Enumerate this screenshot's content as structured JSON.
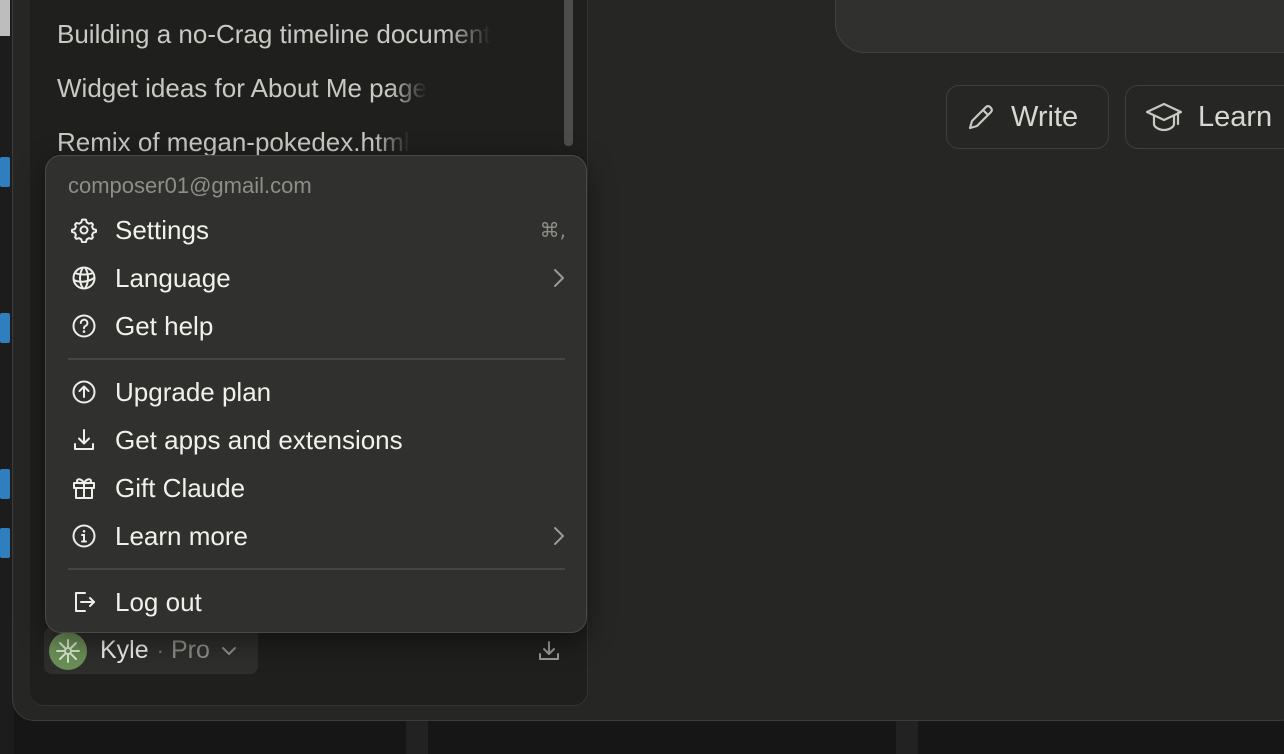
{
  "sidebar": {
    "recent_chats": [
      "Building a no-Crag timeline document",
      "Widget ideas for About Me page",
      "Remix of megan-pokedex.html"
    ]
  },
  "menu": {
    "email": "composer01@gmail.com",
    "items": [
      {
        "label": "Settings",
        "icon": "gear-icon",
        "shortcut": "⌘,"
      },
      {
        "label": "Language",
        "icon": "globe-icon",
        "submenu": true
      },
      {
        "label": "Get help",
        "icon": "help-circle-icon"
      },
      {
        "label": "Upgrade plan",
        "icon": "arrow-up-circle-icon"
      },
      {
        "label": "Get apps and extensions",
        "icon": "download-icon"
      },
      {
        "label": "Gift Claude",
        "icon": "gift-icon"
      },
      {
        "label": "Learn more",
        "icon": "info-icon",
        "submenu": true
      },
      {
        "label": "Log out",
        "icon": "logout-icon"
      }
    ]
  },
  "user": {
    "name": "Kyle",
    "separator": "·",
    "plan": "Pro",
    "avatar_color": "#6b8f57"
  },
  "main": {
    "chips": [
      {
        "label": "Write",
        "icon": "pencil-icon"
      },
      {
        "label": "Learn",
        "icon": "graduation-cap-icon"
      }
    ]
  }
}
